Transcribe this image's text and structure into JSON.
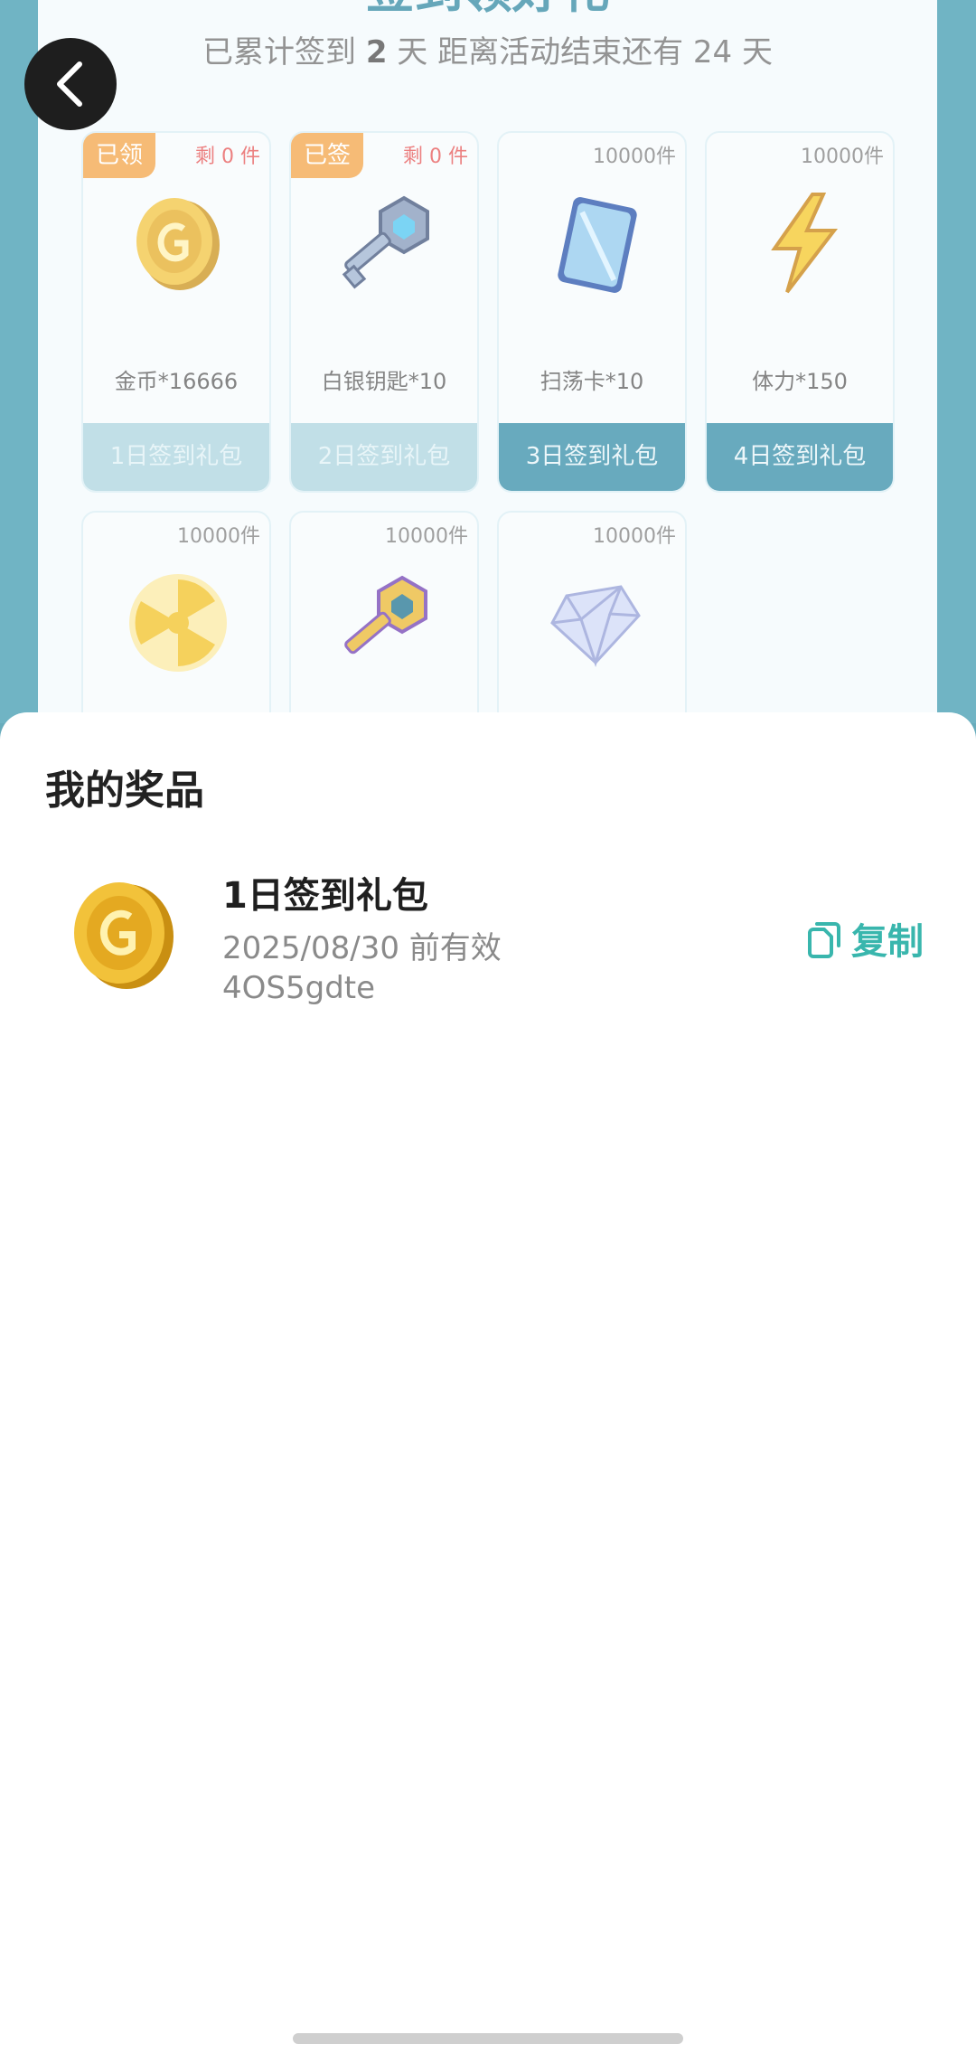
{
  "background": {
    "title_fragment": "签到领好礼",
    "summary_prefix": "已累计签到",
    "signed_days": "2",
    "summary_mid": "天  距离活动结束还有",
    "days_left": "24",
    "summary_suffix": "天",
    "cards": [
      {
        "tag": "已领",
        "count": "剩 0 件",
        "name": "金币*16666",
        "button": "1日签到礼包"
      },
      {
        "tag": "已签",
        "count": "剩 0 件",
        "name": "白银钥匙*10",
        "button": "2日签到礼包"
      },
      {
        "count": "10000件",
        "name": "扫荡卡*10",
        "button": "3日签到礼包"
      },
      {
        "count": "10000件",
        "name": "体力*150",
        "button": "4日签到礼包"
      },
      {
        "count": "10000件"
      },
      {
        "count": "10000件"
      },
      {
        "count": "10000件"
      }
    ]
  },
  "sheet": {
    "title": "我的奖品",
    "prize": {
      "name": "1日签到礼包",
      "valid": "2025/08/30 前有效",
      "code": "4OS5gdte",
      "copy_label": "复制"
    }
  },
  "icons": [
    "back-icon",
    "gold-coin-icon",
    "silver-key-icon",
    "sweep-card-icon",
    "lightning-icon",
    "radiation-icon",
    "gold-key-icon",
    "diamond-icon",
    "copy-icon"
  ],
  "colors": {
    "accent": "#39b6ad",
    "tag": "#f3a142",
    "button": "#2f8aa6"
  }
}
